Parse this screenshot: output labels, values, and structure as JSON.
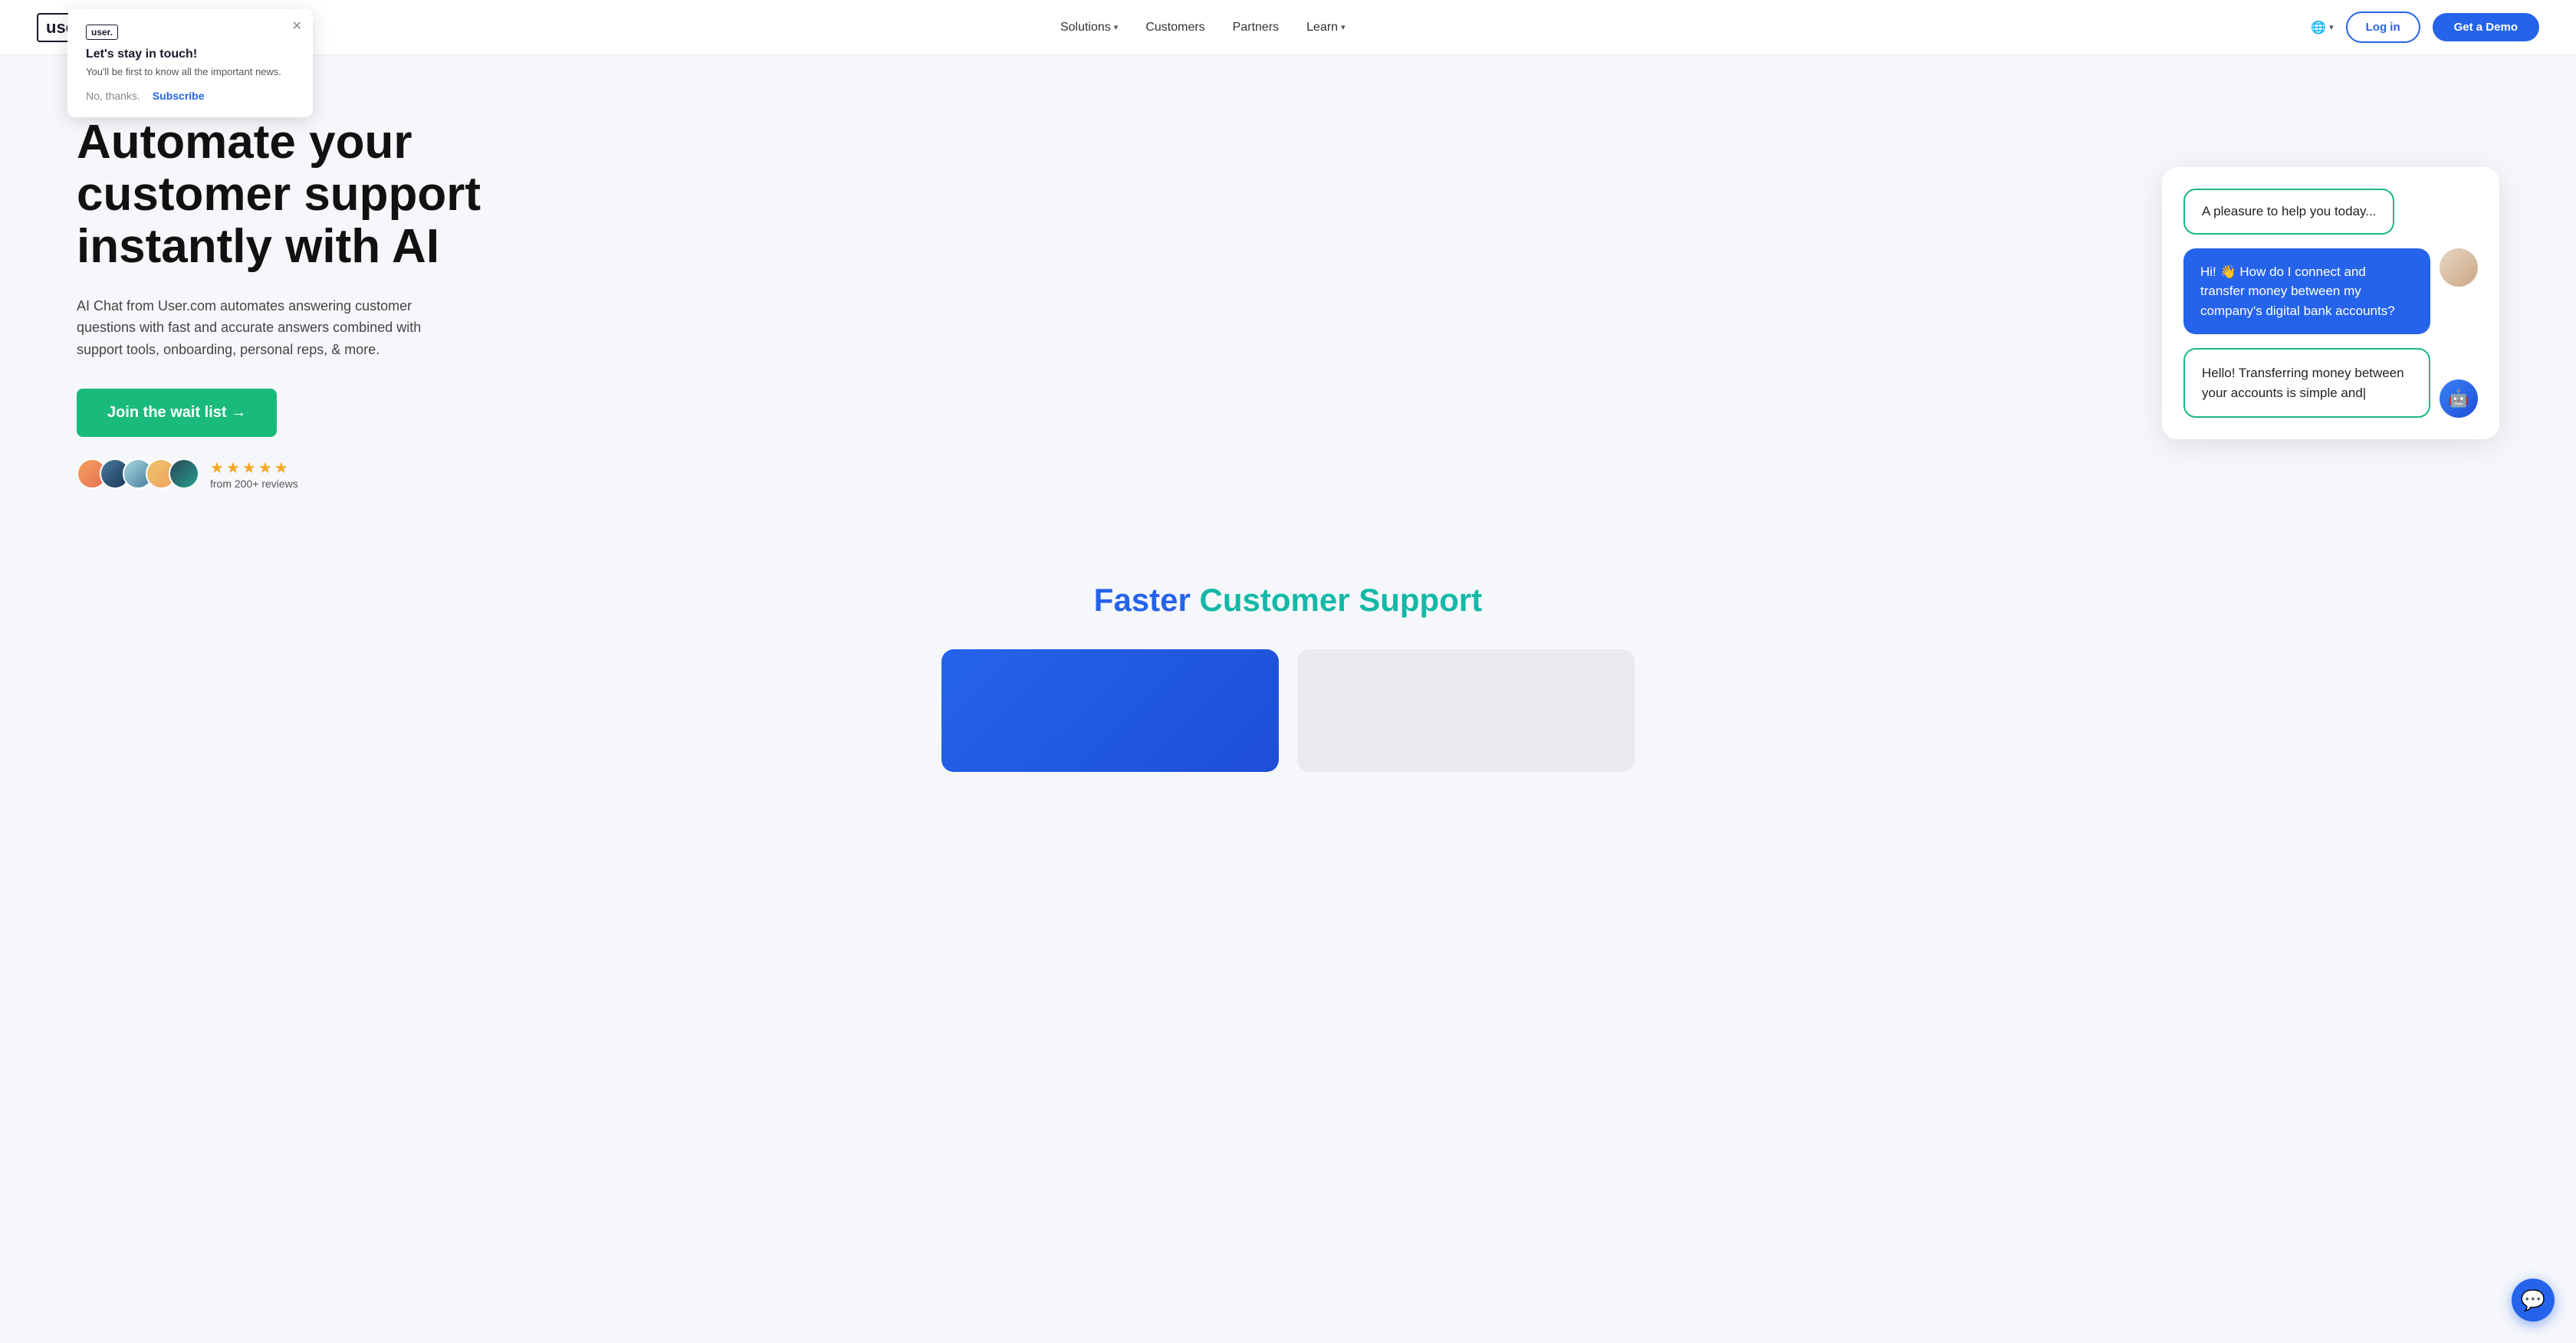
{
  "nav": {
    "logo": "user.",
    "links": [
      {
        "label": "Solutions",
        "hasDropdown": true
      },
      {
        "label": "Customers",
        "hasDropdown": false
      },
      {
        "label": "Partners",
        "hasDropdown": false
      },
      {
        "label": "Learn",
        "hasDropdown": true
      }
    ],
    "login_label": "Log in",
    "demo_label": "Get a Demo"
  },
  "popup": {
    "logo": "user.",
    "title": "Let's stay in touch!",
    "description": "You'll be first to know all the important news.",
    "no_thanks": "No, thanks.",
    "subscribe": "Subscribe"
  },
  "hero": {
    "title": "Automate your customer support instantly with AI",
    "description": "AI Chat from User.com automates answering customer questions with fast and accurate answers combined with support tools, onboarding, personal reps, & more.",
    "cta_label": "Join the wait list →",
    "reviews": {
      "stars": [
        "★",
        "★",
        "★",
        "★",
        "★"
      ],
      "review_text": "from 200+ reviews"
    }
  },
  "chat": {
    "bubble1": "A pleasure to help you today...",
    "bubble2": "Hi! 👋 How do I connect and transfer money between my company's digital bank accounts?",
    "bubble3": "Hello! Transferring money between your accounts is simple and|"
  },
  "faster": {
    "title_blue": "Faster",
    "title_teal": "Customer Support"
  },
  "float_chat_icon": "💬"
}
